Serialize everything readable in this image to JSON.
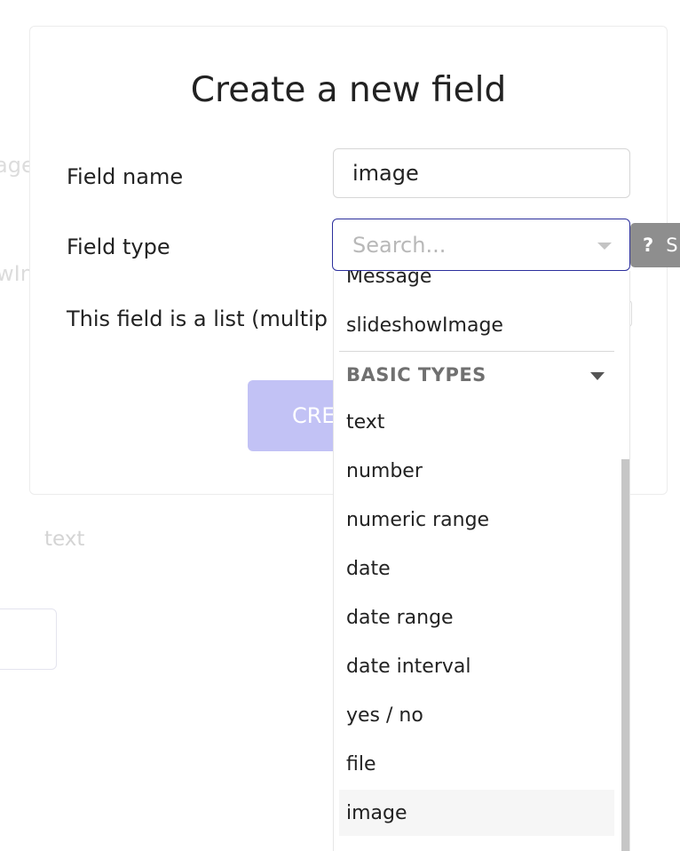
{
  "background": {
    "fragment_1": "age",
    "fragment_2": "wIn",
    "text_value": "text"
  },
  "modal": {
    "title": "Create a new field",
    "field_name_label": "Field name",
    "field_name_value": "image",
    "field_type_label": "Field type",
    "list_label": "This field is a list (multip",
    "create_button": "CRE"
  },
  "field_type_select": {
    "placeholder": "Search...",
    "help_icon": "?",
    "help_label": "S"
  },
  "dropdown": {
    "custom_types_partial": [
      "Message",
      "slideshowImage"
    ],
    "group_header": "BASIC TYPES",
    "basic_types": [
      "text",
      "number",
      "numeric range",
      "date",
      "date range",
      "date interval",
      "yes / no",
      "file",
      "image"
    ],
    "highlighted": "image"
  },
  "colors": {
    "focus_border": "#2c2f9c",
    "create_button_bg": "#c2c2f5",
    "help_button_bg": "#8e8e8e"
  }
}
